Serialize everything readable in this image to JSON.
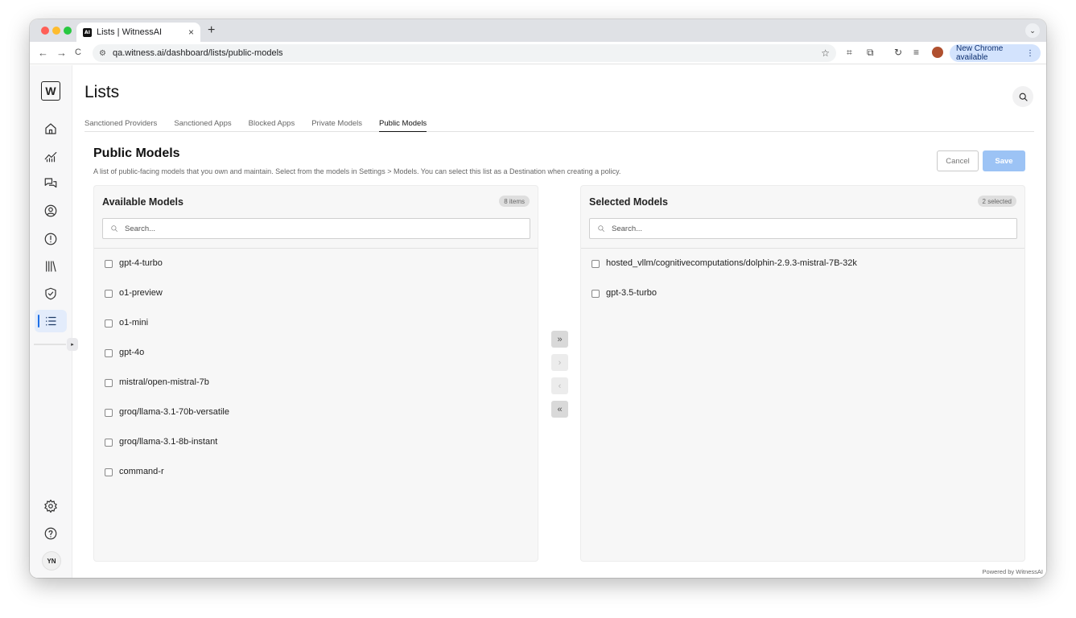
{
  "browser": {
    "tab_title": "Lists | WitnessAI",
    "tab_favicon": "AI",
    "tab_close": "×",
    "new_tab": "+",
    "tab_dropdown": "⌄",
    "back": "←",
    "forward": "→",
    "reload": "C",
    "url": "qa.witness.ai/dashboard/lists/public-models",
    "update_label": "New Chrome available",
    "update_menu": "⋮"
  },
  "sidebar": {
    "logo": "W",
    "items": [
      {
        "icon": "home-icon"
      },
      {
        "icon": "analytics-icon"
      },
      {
        "icon": "conversations-icon"
      },
      {
        "icon": "user-circle-icon"
      },
      {
        "icon": "alert-icon"
      },
      {
        "icon": "library-icon"
      },
      {
        "icon": "shield-check-icon"
      },
      {
        "icon": "list-icon",
        "active": true
      }
    ],
    "bottom_items": [
      {
        "icon": "gear-icon"
      },
      {
        "icon": "help-icon"
      }
    ],
    "user_initials": "YN",
    "collapse_glyph": "▸"
  },
  "page": {
    "title": "Lists",
    "tabs": [
      {
        "label": "Sanctioned Providers",
        "active": false
      },
      {
        "label": "Sanctioned Apps",
        "active": false
      },
      {
        "label": "Blocked Apps",
        "active": false
      },
      {
        "label": "Private Models",
        "active": false
      },
      {
        "label": "Public Models",
        "active": true
      }
    ],
    "section_title": "Public Models",
    "section_desc": "A list of public-facing models that you own and maintain. Select from the models in Settings > Models. You can select this list as a Destination when creating a policy.",
    "cancel_label": "Cancel",
    "save_label": "Save"
  },
  "available": {
    "title": "Available Models",
    "badge": "8 items",
    "search_placeholder": "Search...",
    "items": [
      "gpt-4-turbo",
      "o1-preview",
      "o1-mini",
      "gpt-4o",
      "mistral/open-mistral-7b",
      "groq/llama-3.1-70b-versatile",
      "groq/llama-3.1-8b-instant",
      "command-r"
    ]
  },
  "selected": {
    "title": "Selected Models",
    "badge": "2 selected",
    "search_placeholder": "Search...",
    "items": [
      "hosted_vllm/cognitivecomputations/dolphin-2.9.3-mistral-7B-32k",
      "gpt-3.5-turbo"
    ]
  },
  "transfer": {
    "move_all_right": "»",
    "move_right": "›",
    "move_left": "‹",
    "move_all_left": "«"
  },
  "footer": {
    "powered_by": "Powered by WitnessAI"
  },
  "colors": {
    "accent": "#1e6fe6",
    "save_button": "#9cc3f5",
    "active_nav_bg": "#e3ecfb"
  }
}
